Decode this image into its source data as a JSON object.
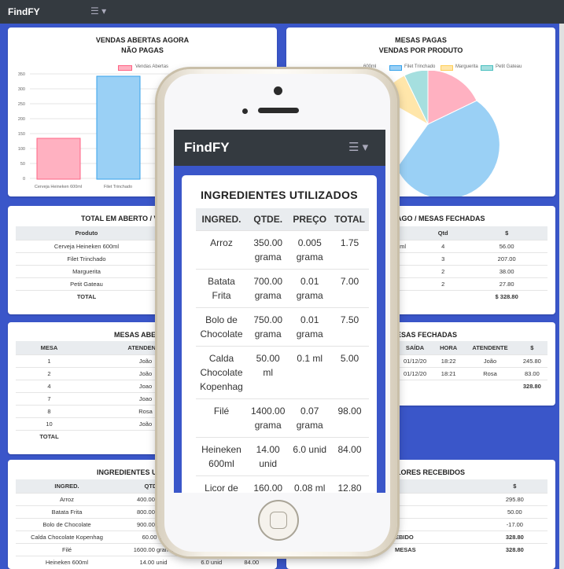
{
  "app": {
    "brand": "FindFY",
    "menu_icon": "☰ ▾"
  },
  "bg_cards": {
    "vendas": {
      "title1": "VENDAS ABERTAS AGORA",
      "title2": "NÃO PAGAS",
      "legend": "Vendas Abertas",
      "yticks": [
        "350",
        "300",
        "250",
        "200",
        "150",
        "100",
        "50",
        "0"
      ],
      "xlabels": [
        "Cerveja Heineken 600ml",
        "Filet Trinchado"
      ]
    },
    "mesas_pagas": {
      "title1": "MESAS PAGAS",
      "title2": "VENDAS POR PRODUTO",
      "legend": [
        "600ml",
        "Filet Trinchado",
        "Marguerita",
        "Petit Gateau"
      ]
    },
    "total_aberto": {
      "title": "TOTAL EM ABERTO / VEN",
      "header": "Produto",
      "rows": [
        "Cerveja Heineken 600ml",
        "Filet Trinchado",
        "Marguerita",
        "Petit Gateau"
      ],
      "total": "TOTAL"
    },
    "pago": {
      "title": "AGO / MESAS FECHADAS",
      "headers": [
        "Qtd",
        "$"
      ],
      "rows": [
        {
          "prod": "0ml",
          "qtd": "4",
          "val": "56.00"
        },
        {
          "prod": "",
          "qtd": "3",
          "val": "207.00"
        },
        {
          "prod": "",
          "qtd": "2",
          "val": "38.00"
        },
        {
          "prod": "",
          "qtd": "2",
          "val": "27.80"
        }
      ],
      "total": "$ 328.80"
    },
    "mesas_abertas": {
      "title": "MESAS ABERT",
      "headers": [
        "MESA",
        "ATENDENTE"
      ],
      "rows": [
        {
          "mesa": "1",
          "at": "João"
        },
        {
          "mesa": "2",
          "at": "João"
        },
        {
          "mesa": "4",
          "at": "Joao"
        },
        {
          "mesa": "7",
          "at": "Joao"
        },
        {
          "mesa": "8",
          "at": "Rosa"
        },
        {
          "mesa": "10",
          "at": "João"
        }
      ],
      "total": "TOTAL"
    },
    "mesas_fechadas": {
      "title": "ESAS FECHADAS",
      "headers": [
        "SAÍDA",
        "HORA",
        "ATENDENTE",
        "$"
      ],
      "rows": [
        {
          "saida": "01/12/20",
          "hora": "18:22",
          "at": "João",
          "val": "245.80"
        },
        {
          "saida": "01/12/20",
          "hora": "18:21",
          "at": "Rosa",
          "val": "83.00"
        }
      ],
      "total": "328.80"
    },
    "ingredientes": {
      "title": "INGREDIENTES UTIL",
      "headers": [
        "INGRED.",
        "QTDE."
      ],
      "rows": [
        {
          "ing": "Arroz",
          "q": "400.00 gram"
        },
        {
          "ing": "Batata Frita",
          "q": "800.00 gram"
        },
        {
          "ing": "Bolo de Chocolate",
          "q": "900.00 gram"
        },
        {
          "ing": "Calda Chocolate Kopenhag",
          "q": "60.00 ml"
        },
        {
          "ing": "Filé",
          "q": "1600.00 grama"
        },
        {
          "ing": "Heineken 600ml",
          "q": "14.00 unid"
        }
      ],
      "last_extra": [
        "6.0 unid",
        "84.00"
      ]
    },
    "valores": {
      "title": "LORES RECEBIDOS",
      "header": "$",
      "rows": [
        {
          "label": "O",
          "val": "295.80"
        },
        {
          "label": "O",
          "val": "50.00"
        },
        {
          "label": "",
          "val": "-17.00"
        },
        {
          "label": "EBIDO",
          "val": "328.80"
        },
        {
          "label": "MESAS",
          "val": "328.80"
        }
      ]
    }
  },
  "phone": {
    "title": "INGREDIENTES UTILIZADOS",
    "headers": [
      "INGRED.",
      "QTDE.",
      "PREÇO",
      "TOTAL"
    ],
    "rows": [
      {
        "ing": "Arroz",
        "q": "350.00 grama",
        "p": "0.005 grama",
        "t": "1.75"
      },
      {
        "ing": "Batata Frita",
        "q": "700.00 grama",
        "p": "0.01 grama",
        "t": "7.00"
      },
      {
        "ing": "Bolo de Chocolate",
        "q": "750.00 grama",
        "p": "0.01 grama",
        "t": "7.50"
      },
      {
        "ing": "Calda Chocolate Kopenhag",
        "q": "50.00 ml",
        "p": "0.1 ml",
        "t": "5.00"
      },
      {
        "ing": "Filé",
        "q": "1400.00 grama",
        "p": "0.07 grama",
        "t": "98.00"
      },
      {
        "ing": "Heineken 600ml",
        "q": "14.00 unid",
        "p": "6.0 unid",
        "t": "84.00"
      },
      {
        "ing": "Licor de Laranja",
        "q": "160.00 ml",
        "p": "0.08 ml",
        "t": "12.80"
      }
    ]
  },
  "colors": {
    "bg": "#3a56c9",
    "nav": "#343a40",
    "pink": "#ffb1c1",
    "blue": "#9ad0f5",
    "yellow": "#ffe6aa",
    "teal": "#a5dfdf"
  }
}
